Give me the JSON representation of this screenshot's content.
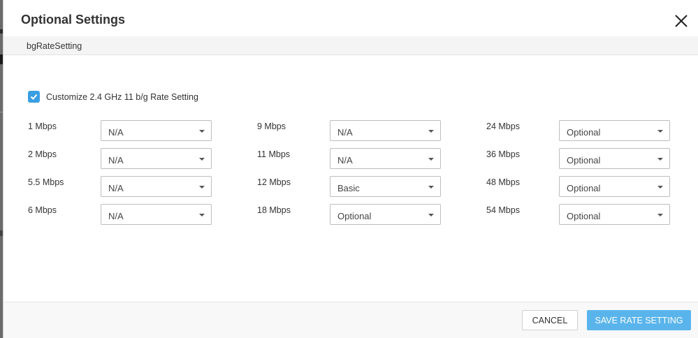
{
  "modal": {
    "title": "Optional Settings",
    "subheader": "bgRateSetting"
  },
  "customize": {
    "checked": true,
    "label": "Customize 2.4 GHz 11 b/g Rate Setting"
  },
  "rates": [
    {
      "label": "1 Mbps",
      "value": "N/A"
    },
    {
      "label": "2 Mbps",
      "value": "N/A"
    },
    {
      "label": "5.5 Mbps",
      "value": "N/A"
    },
    {
      "label": "6 Mbps",
      "value": "N/A"
    },
    {
      "label": "9 Mbps",
      "value": "N/A"
    },
    {
      "label": "11 Mbps",
      "value": "N/A"
    },
    {
      "label": "12 Mbps",
      "value": "Basic"
    },
    {
      "label": "18 Mbps",
      "value": "Optional"
    },
    {
      "label": "24 Mbps",
      "value": "Optional"
    },
    {
      "label": "36 Mbps",
      "value": "Optional"
    },
    {
      "label": "48 Mbps",
      "value": "Optional"
    },
    {
      "label": "54 Mbps",
      "value": "Optional"
    }
  ],
  "footer": {
    "cancel_label": "CANCEL",
    "save_label": "SAVE RATE SETTING"
  },
  "colors": {
    "accent": "#3a9ee3",
    "save_button": "#5ab4ec"
  }
}
